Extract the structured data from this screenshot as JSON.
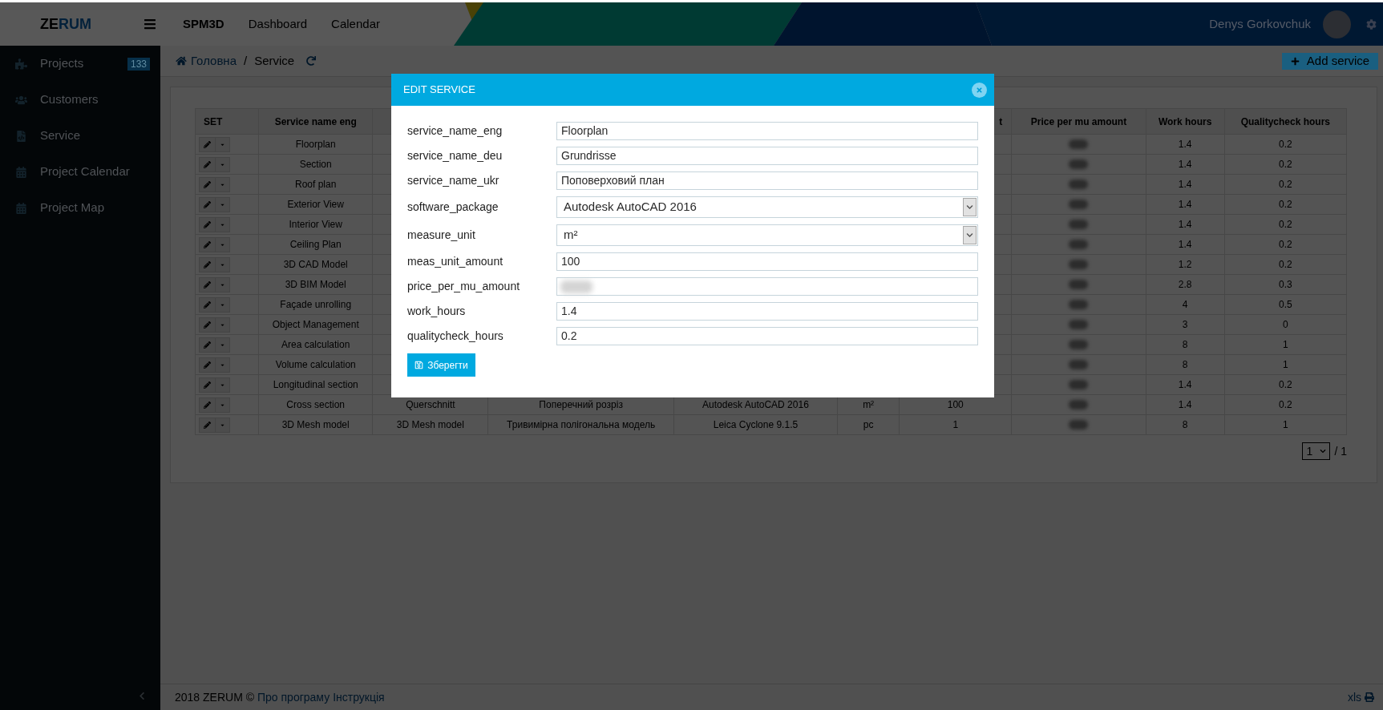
{
  "header": {
    "logo": [
      "ZE",
      "RUM"
    ],
    "nav": [
      {
        "label": "SPM3D",
        "kind": "brand"
      },
      {
        "label": "Dashboard",
        "kind": "link"
      },
      {
        "label": "Calendar",
        "kind": "link"
      }
    ],
    "user": {
      "name": "Denys Gorkovchuk"
    }
  },
  "sidebar": {
    "items": [
      {
        "label": "Projects",
        "badge": "133"
      },
      {
        "label": "Customers"
      },
      {
        "label": "Service"
      },
      {
        "label": "Project Calendar"
      },
      {
        "label": "Project Map"
      }
    ]
  },
  "breadcrumb": {
    "items": [
      {
        "label": "Головна",
        "kind": "link"
      },
      {
        "label": "Service",
        "kind": "current"
      }
    ],
    "separator": "/"
  },
  "toolbar": {
    "add_button": "Add service"
  },
  "table": {
    "columns": [
      {
        "label": "SET"
      },
      {
        "label": "Service name eng"
      },
      {},
      {},
      {},
      {},
      {
        "label": "t"
      },
      {
        "label": "Price per mu amount"
      },
      {
        "label": "Work hours"
      },
      {
        "label": "Qualitycheck hours"
      }
    ],
    "rows": [
      {
        "cells": [
          {
            "kind": "actions"
          },
          {
            "text": "Floorplan"
          },
          {},
          {},
          {},
          {},
          {},
          {
            "kind": "blurred"
          },
          {
            "text": "1.4"
          },
          {
            "text": "0.2"
          }
        ]
      },
      {
        "cells": [
          {
            "kind": "actions"
          },
          {
            "text": "Section"
          },
          {},
          {},
          {},
          {},
          {},
          {
            "kind": "blurred"
          },
          {
            "text": "1.4"
          },
          {
            "text": "0.2"
          }
        ]
      },
      {
        "cells": [
          {
            "kind": "actions"
          },
          {
            "text": "Roof plan"
          },
          {},
          {},
          {},
          {},
          {},
          {
            "kind": "blurred"
          },
          {
            "text": "1.4"
          },
          {
            "text": "0.2"
          }
        ]
      },
      {
        "cells": [
          {
            "kind": "actions"
          },
          {
            "text": "Exterior View"
          },
          {},
          {},
          {},
          {},
          {},
          {
            "kind": "blurred"
          },
          {
            "text": "1.4"
          },
          {
            "text": "0.2"
          }
        ]
      },
      {
        "cells": [
          {
            "kind": "actions"
          },
          {
            "text": "Interior View"
          },
          {},
          {},
          {},
          {},
          {},
          {
            "kind": "blurred"
          },
          {
            "text": "1.4"
          },
          {
            "text": "0.2"
          }
        ]
      },
      {
        "cells": [
          {
            "kind": "actions"
          },
          {
            "text": "Ceiling Plan"
          },
          {},
          {},
          {},
          {},
          {},
          {
            "kind": "blurred"
          },
          {
            "text": "1.4"
          },
          {
            "text": "0.2"
          }
        ]
      },
      {
        "cells": [
          {
            "kind": "actions"
          },
          {
            "text": "3D CAD Model"
          },
          {},
          {},
          {},
          {},
          {},
          {
            "kind": "blurred"
          },
          {
            "text": "1.2"
          },
          {
            "text": "0.2"
          }
        ]
      },
      {
        "cells": [
          {
            "kind": "actions"
          },
          {
            "text": "3D BIM Model"
          },
          {},
          {},
          {},
          {},
          {},
          {
            "kind": "blurred"
          },
          {
            "text": "2.8"
          },
          {
            "text": "0.3"
          }
        ]
      },
      {
        "cells": [
          {
            "kind": "actions"
          },
          {
            "text": "Façade unrolling"
          },
          {},
          {},
          {},
          {},
          {},
          {
            "kind": "blurred"
          },
          {
            "text": "4"
          },
          {
            "text": "0.5"
          }
        ]
      },
      {
        "cells": [
          {
            "kind": "actions"
          },
          {
            "text": "Object Management"
          },
          {},
          {},
          {},
          {},
          {},
          {
            "kind": "blurred"
          },
          {
            "text": "3"
          },
          {
            "text": "0"
          }
        ]
      },
      {
        "cells": [
          {
            "kind": "actions"
          },
          {
            "text": "Area calculation"
          },
          {},
          {},
          {},
          {},
          {},
          {
            "kind": "blurred"
          },
          {
            "text": "8"
          },
          {
            "text": "1"
          }
        ]
      },
      {
        "cells": [
          {
            "kind": "actions"
          },
          {
            "text": "Volume calculation"
          },
          {},
          {},
          {},
          {},
          {},
          {
            "kind": "blurred"
          },
          {
            "text": "8"
          },
          {
            "text": "1"
          }
        ]
      },
      {
        "cells": [
          {
            "kind": "actions"
          },
          {
            "text": "Longitudinal section"
          },
          {},
          {},
          {},
          {},
          {},
          {
            "kind": "blurred"
          },
          {
            "text": "1.4"
          },
          {
            "text": "0.2"
          }
        ]
      },
      {
        "cells": [
          {
            "kind": "actions"
          },
          {
            "text": "Cross section"
          },
          {
            "text": "Querschnitt"
          },
          {
            "text": "Поперечний розріз"
          },
          {
            "text": "Autodesk AutoCAD 2016"
          },
          {
            "text": "m²"
          },
          {
            "text": "100"
          },
          {
            "kind": "blurred"
          },
          {
            "text": "1.4"
          },
          {
            "text": "0.2"
          }
        ]
      },
      {
        "cells": [
          {
            "kind": "actions"
          },
          {
            "text": "3D Mesh model"
          },
          {
            "text": "3D Mesh model"
          },
          {
            "text": "Тривимірна полігональна модель"
          },
          {
            "text": "Leica Cyclone 9.1.5"
          },
          {
            "text": "pc"
          },
          {
            "text": "1"
          },
          {
            "kind": "blurred"
          },
          {
            "text": "8"
          },
          {
            "text": "1"
          }
        ]
      }
    ]
  },
  "pagination": {
    "page": "1",
    "total": "/ 1"
  },
  "modal": {
    "title": "EDIT SERVICE",
    "fields": [
      {
        "label": "service_name_eng",
        "kind": "text",
        "value": "Floorplan"
      },
      {
        "label": "service_name_deu",
        "kind": "text",
        "value": "Grundrisse"
      },
      {
        "label": "service_name_ukr",
        "kind": "text",
        "value": "Поповерховий план"
      },
      {
        "label": "software_package",
        "kind": "select",
        "value": "Autodesk AutoCAD 2016"
      },
      {
        "label": "measure_unit",
        "kind": "select",
        "value": "m²"
      },
      {
        "label": "meas_unit_amount",
        "kind": "text",
        "value": "100"
      },
      {
        "label": "price_per_mu_amount",
        "kind": "text",
        "blurred": true
      },
      {
        "label": "work_hours",
        "kind": "text",
        "value": "1.4"
      },
      {
        "label": "qualitycheck_hours",
        "kind": "text",
        "value": "0.2"
      }
    ],
    "save_button": "Зберегти"
  },
  "footer": {
    "copyright": "2018 ZERUM ©",
    "links": [
      "Про програму",
      "Інструкція"
    ],
    "export": "xls"
  }
}
